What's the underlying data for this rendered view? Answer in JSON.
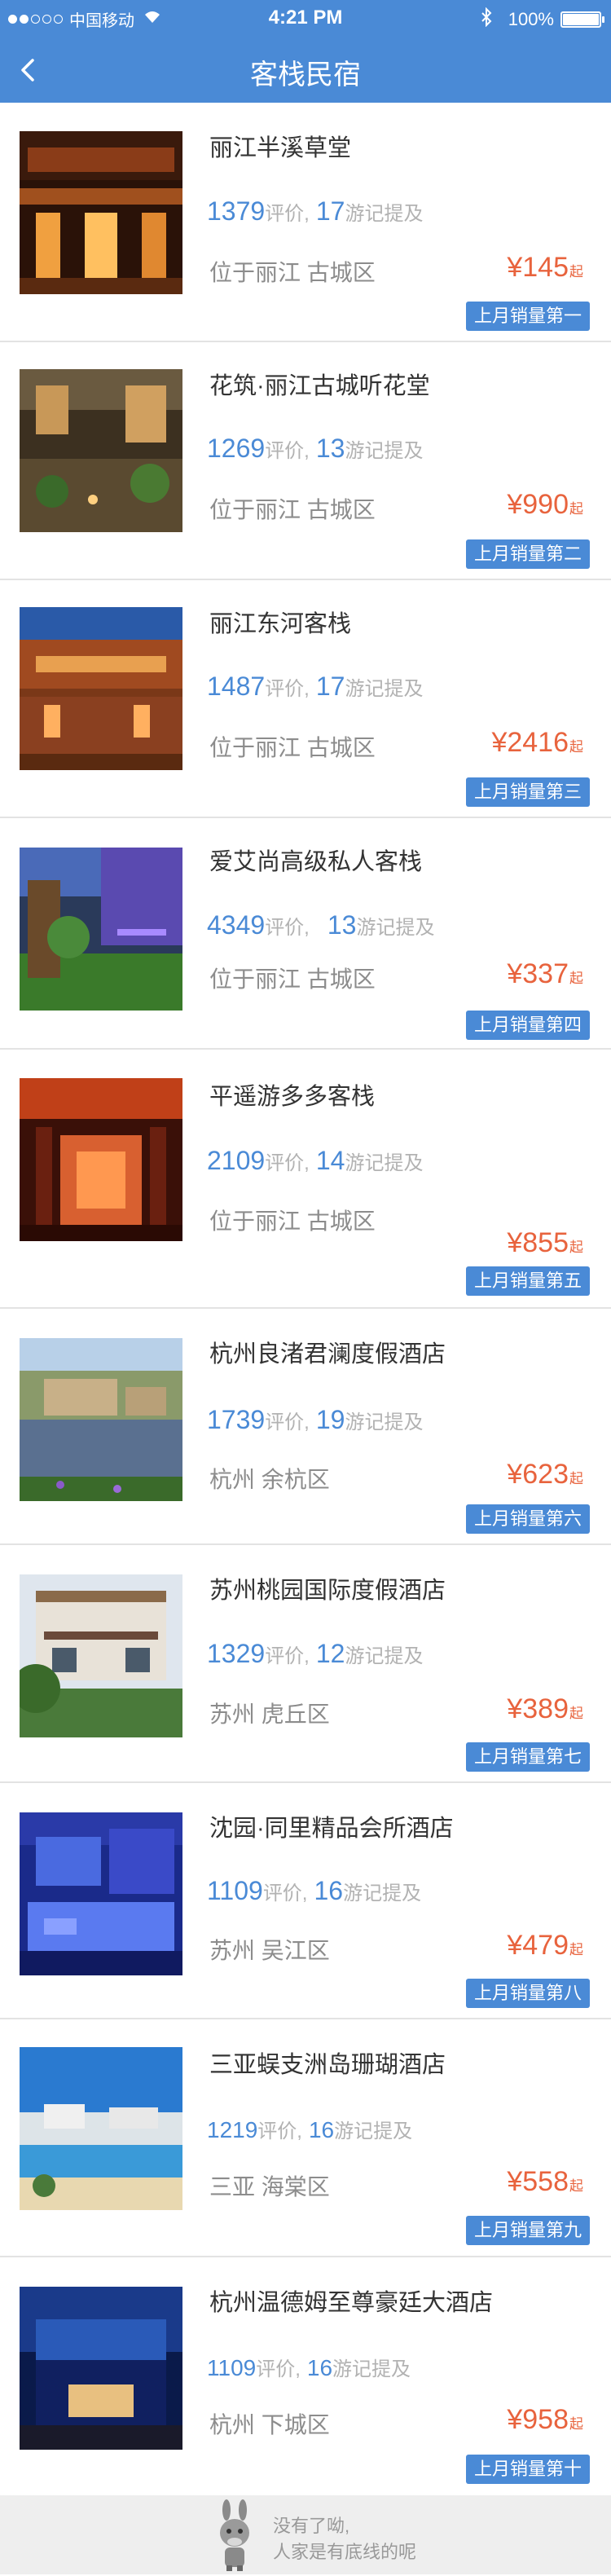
{
  "status_bar": {
    "carrier": "中国移动",
    "time": "4:21 PM",
    "battery": "100%",
    "battery_level": 1.0
  },
  "nav": {
    "title": "客栈民宿"
  },
  "list": {
    "items": [
      {
        "name": "丽江半溪草堂",
        "reviews": "1379",
        "review_label": "评价,",
        "notes": "17",
        "notes_label": "游记提及",
        "location": "位于丽江 古城区",
        "price": "¥145",
        "price_suffix": "起",
        "badge": "上月销量第一"
      },
      {
        "name": "花筑·丽江古城听花堂",
        "reviews": "1269",
        "review_label": "评价,",
        "notes": "13",
        "notes_label": "游记提及",
        "location": "位于丽江 古城区",
        "price": "¥990",
        "price_suffix": "起",
        "badge": "上月销量第二"
      },
      {
        "name": "丽江东河客栈",
        "reviews": "1487",
        "review_label": "评价,",
        "notes": "17",
        "notes_label": "游记提及",
        "location": "位于丽江 古城区",
        "price": "¥2416",
        "price_suffix": "起",
        "badge": "上月销量第三"
      },
      {
        "name": "爱艾尚高级私人客栈",
        "reviews": "4349",
        "review_label": "评价,",
        "notes": "13",
        "notes_label": "游记提及",
        "location": "位于丽江 古城区",
        "price": "¥337",
        "price_suffix": "起",
        "badge": "上月销量第四"
      },
      {
        "name": "平遥游多多客栈",
        "reviews": "2109",
        "review_label": "评价,",
        "notes": "14",
        "notes_label": "游记提及",
        "location": "位于丽江 古城区",
        "price": "¥855",
        "price_suffix": "起",
        "badge": "上月销量第五"
      },
      {
        "name": "杭州良渚君澜度假酒店",
        "reviews": "1739",
        "review_label": "评价,",
        "notes": "19",
        "notes_label": "游记提及",
        "location": "杭州 余杭区",
        "price": "¥623",
        "price_suffix": "起",
        "badge": "上月销量第六"
      },
      {
        "name": "苏州桃园国际度假酒店",
        "reviews": "1329",
        "review_label": "评价,",
        "notes": "12",
        "notes_label": "游记提及",
        "location": "苏州 虎丘区",
        "price": "¥389",
        "price_suffix": "起",
        "badge": "上月销量第七"
      },
      {
        "name": "沈园·同里精品会所酒店",
        "reviews": "1109",
        "review_label": "评价,",
        "notes": "16",
        "notes_label": "游记提及",
        "location": "苏州 吴江区",
        "price": "¥479",
        "price_suffix": "起",
        "badge": "上月销量第八"
      },
      {
        "name": "三亚蜈支洲岛珊瑚酒店",
        "reviews": "1219",
        "review_label": "评价,",
        "notes": "16",
        "notes_label": "游记提及",
        "location": "三亚 海棠区",
        "price": "¥558",
        "price_suffix": "起",
        "badge": "上月销量第九"
      },
      {
        "name": "杭州温德姆至尊豪廷大酒店",
        "reviews": "1109",
        "review_label": "评价,",
        "notes": "16",
        "notes_label": "游记提及",
        "location": "杭州 下城区",
        "price": "¥958",
        "price_suffix": "起",
        "badge": "上月销量第十"
      }
    ]
  },
  "footer": {
    "line1": "没有了呦,",
    "line2": "人家是有底线的呢",
    "mascot_icon": "donkey-mascot-icon"
  },
  "colors": {
    "accent": "#4a8ad6",
    "price": "#e8633d",
    "muted": "#8c8c8c"
  }
}
